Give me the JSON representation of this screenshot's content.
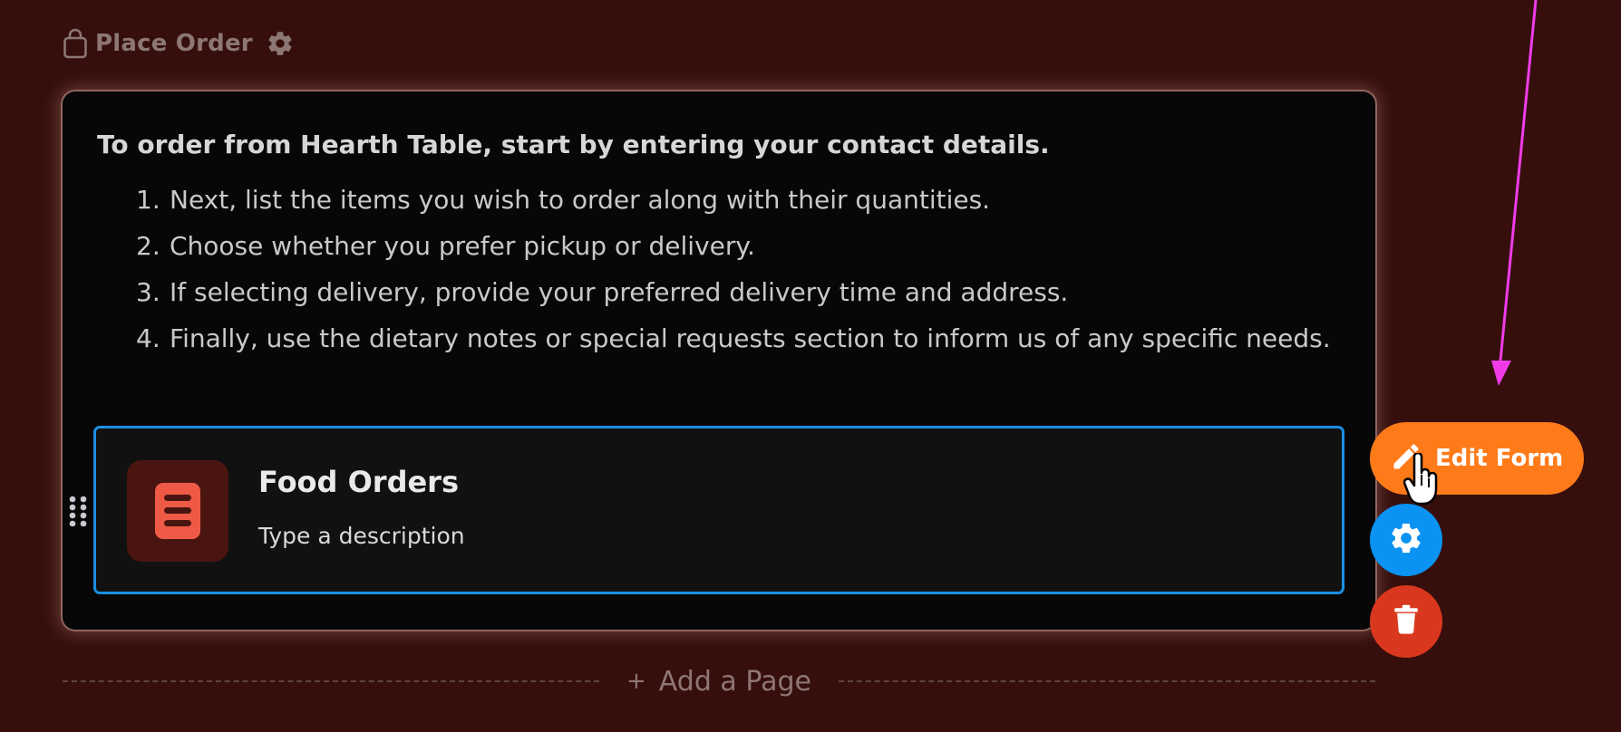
{
  "page_header": {
    "title": "Place Order",
    "icons": [
      "shopping-bag-icon",
      "gear-icon"
    ]
  },
  "card": {
    "intro": "To order from Hearth Table, start by entering your contact details.",
    "steps": [
      {
        "number": "1.",
        "text": "Next, list the items you wish to order along with their quantities."
      },
      {
        "number": "2.",
        "text": "Choose whether you prefer pickup or delivery."
      },
      {
        "number": "3.",
        "text": "If selecting delivery, provide your preferred delivery time and address."
      },
      {
        "number": "4.",
        "text": "Finally, use the dietary notes or special requests section to inform us of any specific needs."
      }
    ],
    "form_block": {
      "title": "Food Orders",
      "description": "Type a description",
      "icon": "form-list-icon"
    }
  },
  "actions": {
    "edit_form_label": "Edit Form",
    "settings_icon": "gear-icon",
    "delete_icon": "trash-icon"
  },
  "add_page": {
    "plus": "+",
    "label": "Add a Page"
  },
  "colors": {
    "background": "#360f0d",
    "card": "#070707",
    "selection_border": "#1a8fe0",
    "edit_button": "#ff7b1a",
    "settings_button": "#0a93f2",
    "delete_button": "#d9381e",
    "annotation_arrow": "#f03ce8"
  }
}
